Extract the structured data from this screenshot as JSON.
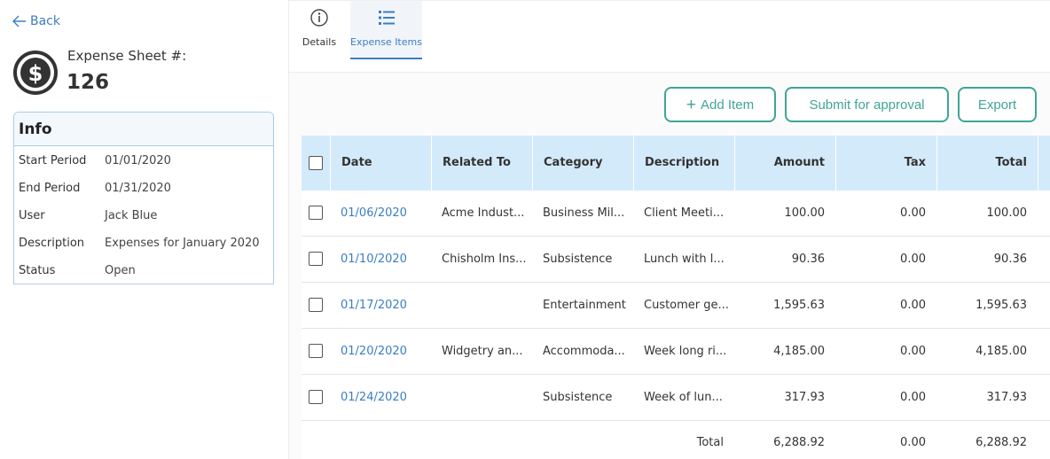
{
  "nav": {
    "back_label": "Back"
  },
  "sheet": {
    "label": "Expense Sheet #:",
    "number": "126"
  },
  "info": {
    "title": "Info",
    "fields": [
      {
        "key": "Start Period",
        "value": "01/01/2020"
      },
      {
        "key": "End Period",
        "value": "01/31/2020"
      },
      {
        "key": "User",
        "value": "Jack Blue"
      },
      {
        "key": "Description",
        "value": "Expenses for January 2020"
      },
      {
        "key": "Status",
        "value": "Open"
      }
    ]
  },
  "tabs": [
    {
      "label": "Details",
      "icon": "info-circle-icon"
    },
    {
      "label": "Expense Items",
      "icon": "list-icon",
      "active": true
    }
  ],
  "toolbar": {
    "add_label": "Add Item",
    "submit_label": "Submit for approval",
    "export_label": "Export"
  },
  "table": {
    "columns": [
      "Date",
      "Related To",
      "Category",
      "Description",
      "Amount",
      "Tax",
      "Total"
    ],
    "rows": [
      {
        "date": "01/06/2020",
        "related": "Acme Indust...",
        "category": "Business Mil...",
        "description": "Client Meeti...",
        "amount": "100.00",
        "tax": "0.00",
        "total": "100.00"
      },
      {
        "date": "01/10/2020",
        "related": "Chisholm Ins...",
        "category": "Subsistence",
        "description": "Lunch with l...",
        "amount": "90.36",
        "tax": "0.00",
        "total": "90.36"
      },
      {
        "date": "01/17/2020",
        "related": "",
        "category": "Entertainment",
        "description": "Customer ge...",
        "amount": "1,595.63",
        "tax": "0.00",
        "total": "1,595.63"
      },
      {
        "date": "01/20/2020",
        "related": "Widgetry an...",
        "category": "Accommoda...",
        "description": "Week long ri...",
        "amount": "4,185.00",
        "tax": "0.00",
        "total": "4,185.00"
      },
      {
        "date": "01/24/2020",
        "related": "",
        "category": "Subsistence",
        "description": "Week of lun...",
        "amount": "317.93",
        "tax": "0.00",
        "total": "317.93"
      }
    ],
    "footer": {
      "label": "Total",
      "amount": "6,288.92",
      "tax": "0.00",
      "total": "6,288.92"
    }
  },
  "colors": {
    "accent": "#3b7dc4",
    "button": "#3fa597",
    "header_bg": "#d3eafb"
  }
}
